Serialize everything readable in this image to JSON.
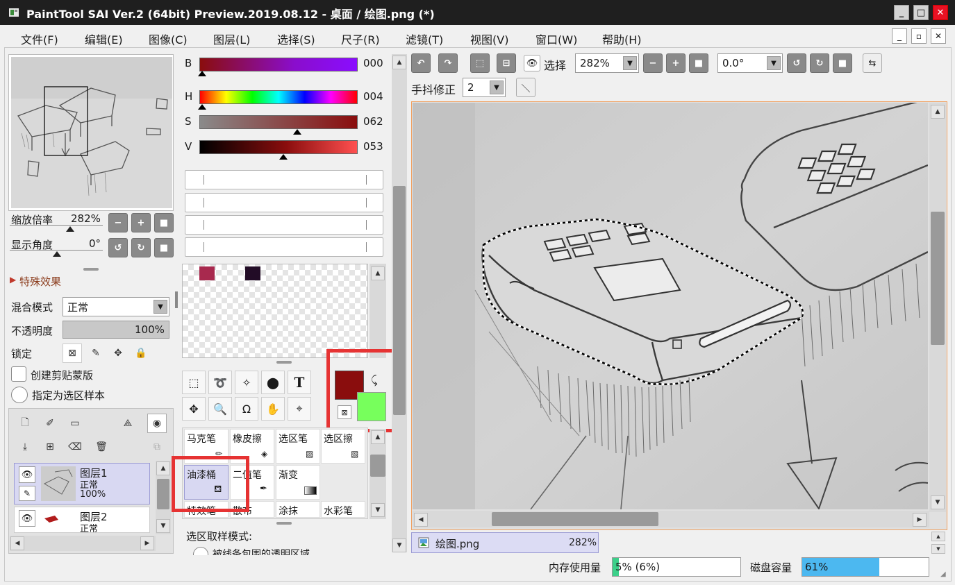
{
  "window": {
    "title": "PaintTool SAI Ver.2 (64bit) Preview.2019.08.12 - 桌面 / 绘图.png (*)",
    "minimize": "_",
    "maximize": "□",
    "close": "✕"
  },
  "menu": [
    "文件(F)",
    "编辑(E)",
    "图像(C)",
    "图层(L)",
    "选择(S)",
    "尺子(R)",
    "滤镜(T)",
    "视图(V)",
    "窗口(W)",
    "帮助(H)"
  ],
  "menu_buttons": {
    "minimize": "_",
    "restore": "▫",
    "close": "✕"
  },
  "navigator": {
    "zoom_label": "缩放倍率",
    "zoom_value": "282%",
    "angle_label": "显示角度",
    "angle_value": "0°"
  },
  "layer_props": {
    "effects": "特殊效果",
    "blend_label": "混合模式",
    "blend_value": "正常",
    "opacity_label": "不透明度",
    "opacity_value": "100%",
    "opacity_fraction": 1.0,
    "lock_label": "锁定",
    "clip_label": "创建剪贴蒙版",
    "sample_label": "指定为选区样本"
  },
  "layers": [
    {
      "name": "图层1",
      "mode": "正常",
      "opacity": "100%",
      "selected": true
    },
    {
      "name": "图层2",
      "mode": "正常"
    }
  ],
  "color": {
    "B": {
      "label": "B",
      "value": "000"
    },
    "H": {
      "label": "H",
      "value": "004"
    },
    "S": {
      "label": "S",
      "value": "062"
    },
    "V": {
      "label": "V",
      "value": "053"
    },
    "primary": "#8a0d0d",
    "secondary": "#77ff5c",
    "swatches": [
      "#a8294e",
      "#220c26"
    ]
  },
  "tools": {
    "text": "T"
  },
  "brushes": [
    [
      "马克笔",
      "橡皮擦",
      "选区笔",
      "选区擦"
    ],
    [
      "油漆桶",
      "二值笔",
      "渐变",
      ""
    ],
    [
      "特效笔",
      "散布",
      "涂抹",
      "水彩笔"
    ]
  ],
  "tool_settings": {
    "title": "选区取样模式:",
    "option": "被线条包围的透明区域"
  },
  "canvas_toolbar": {
    "select_label": "选择",
    "zoom": "282%",
    "rotation": "0.0°",
    "stabilizer_label": "手抖修正",
    "stabilizer_value": "2"
  },
  "doc_tab": {
    "name": "绘图.png",
    "zoom": "282%"
  },
  "status": {
    "memory_label": "内存使用量",
    "memory_value": "5% (6%)",
    "memory_fraction": 0.05,
    "disk_label": "磁盘容量",
    "disk_value": "61%",
    "disk_fraction": 0.61
  }
}
